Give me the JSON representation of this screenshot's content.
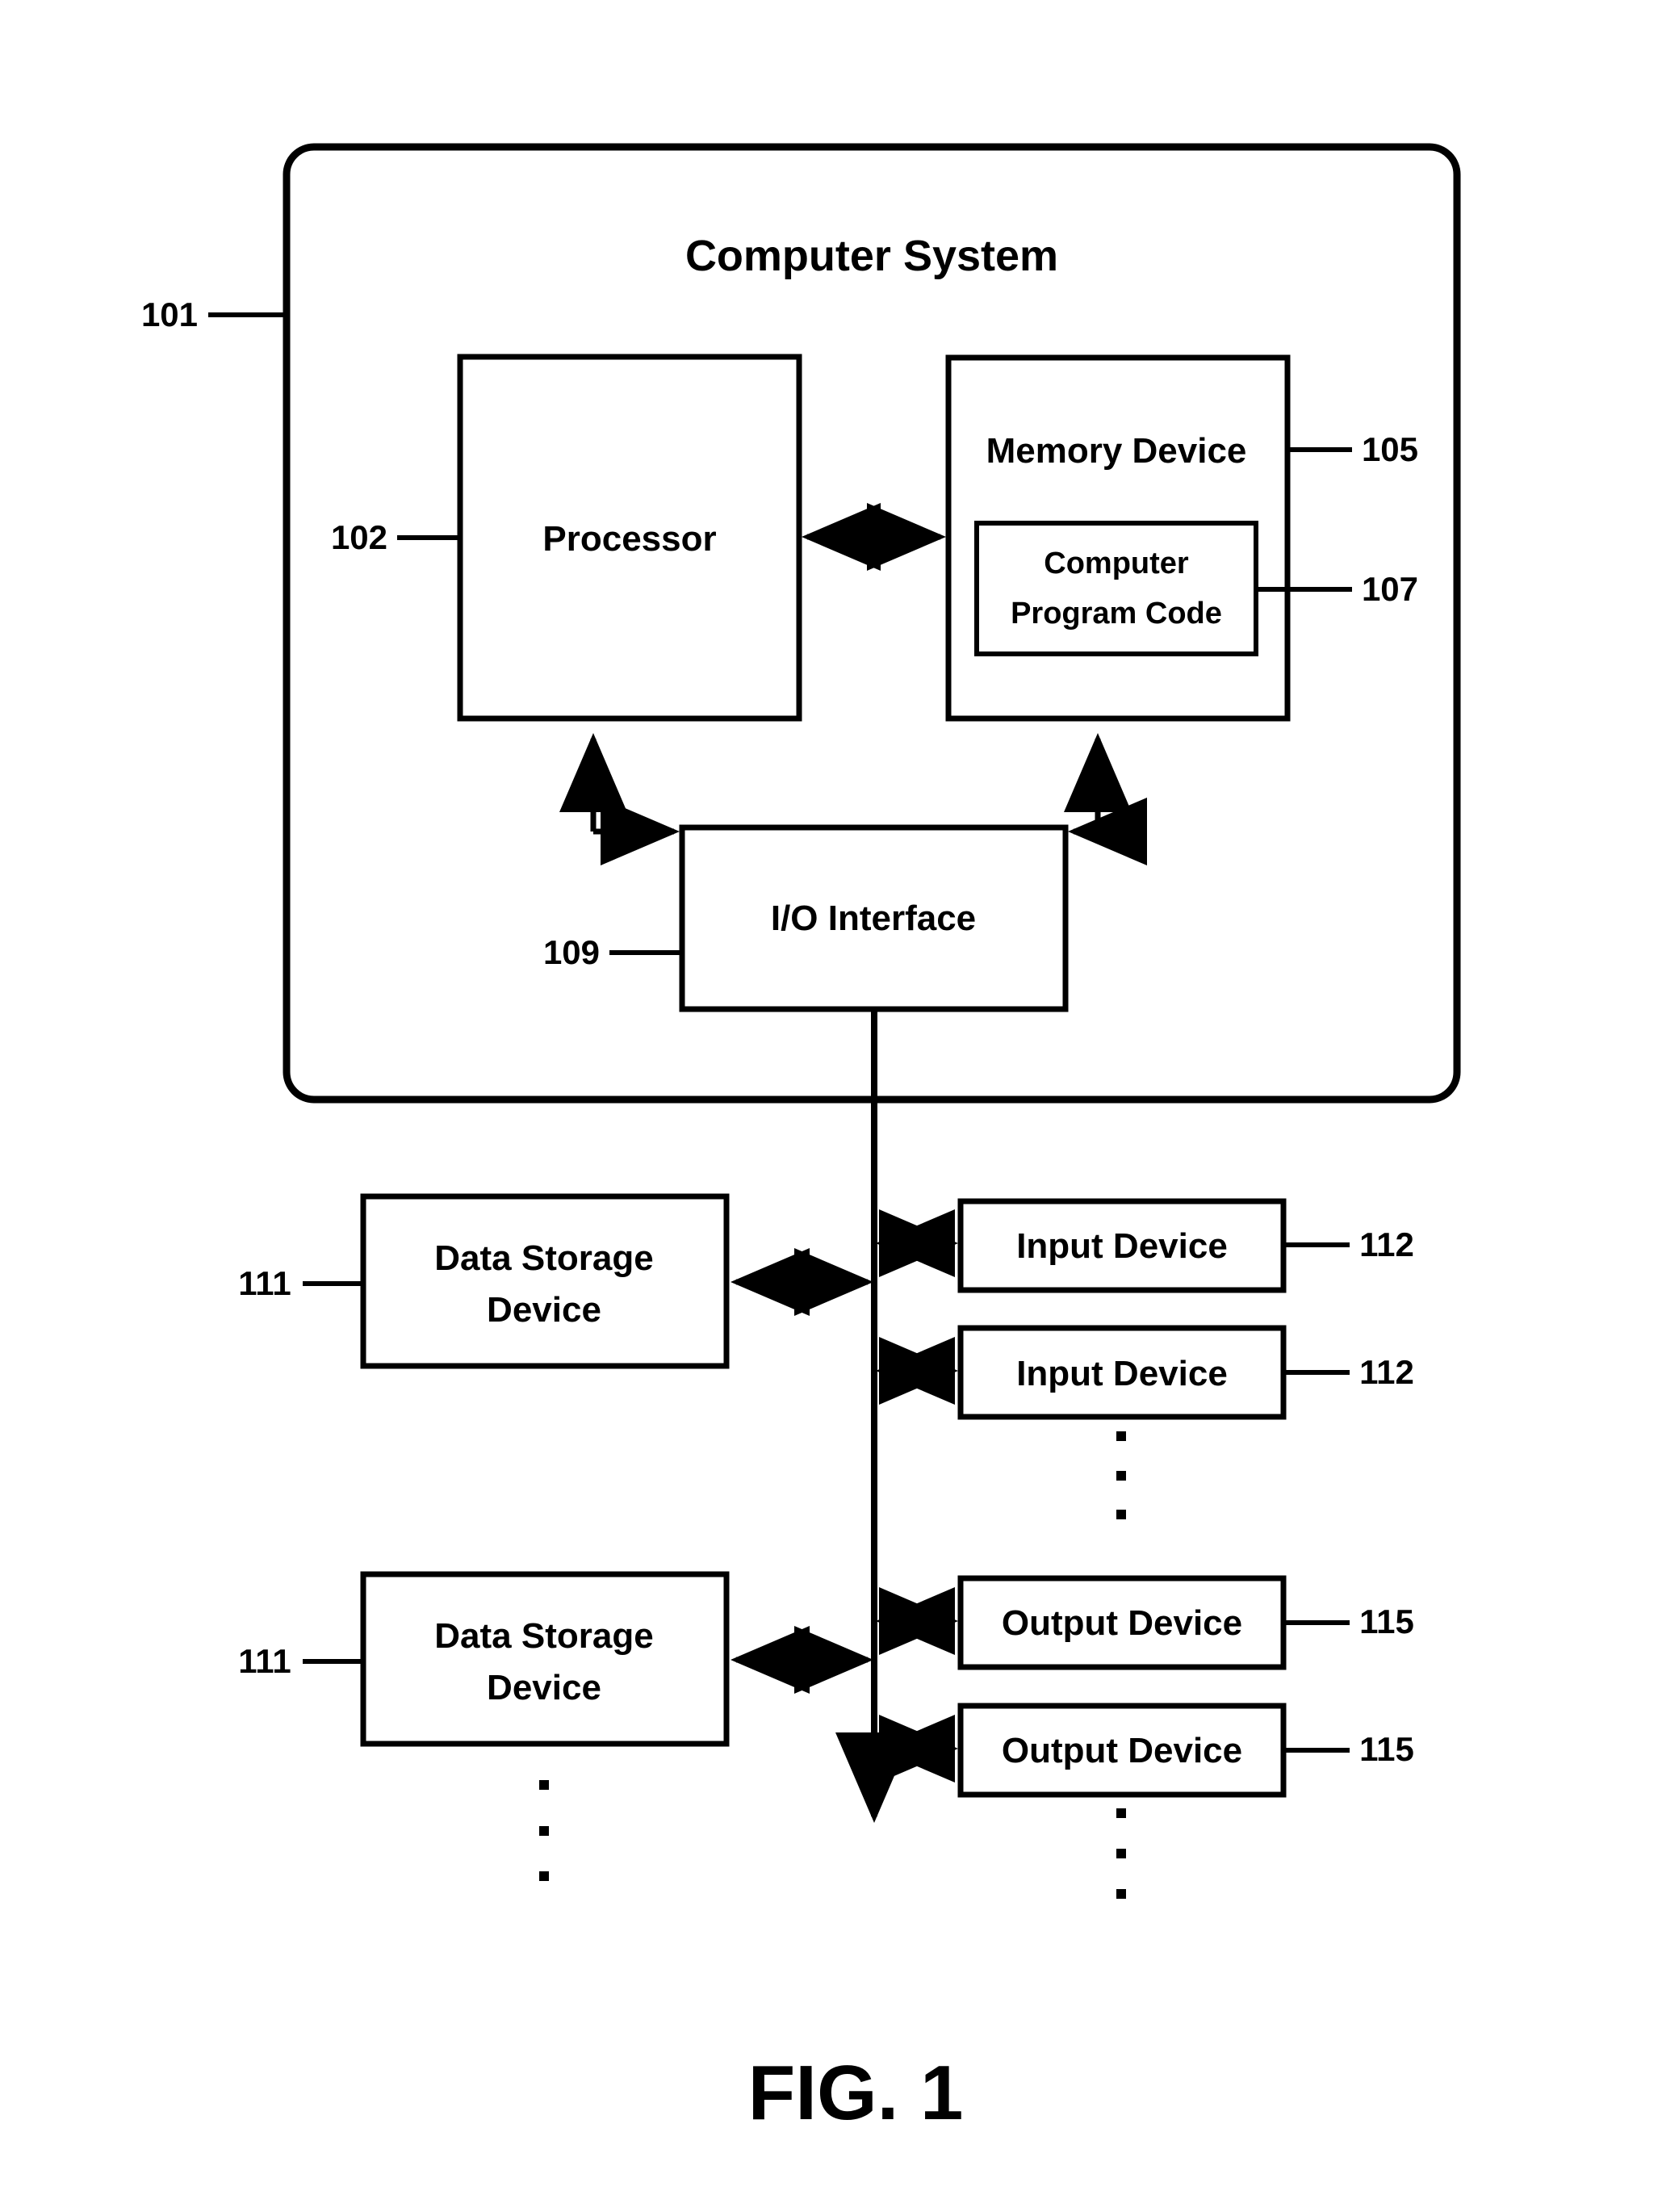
{
  "figure": {
    "caption": "FIG. 1",
    "title": "Computer System",
    "title_ref": "101"
  },
  "blocks": {
    "processor": {
      "label": "Processor",
      "ref": "102"
    },
    "memory_device": {
      "label": "Memory Device",
      "ref": "105"
    },
    "computer_program_code": {
      "label_line1": "Computer",
      "label_line2": "Program Code",
      "ref": "107"
    },
    "io_interface": {
      "label": "I/O Interface",
      "ref": "109"
    }
  },
  "peripherals": {
    "data_storage": [
      {
        "label_line1": "Data Storage",
        "label_line2": "Device",
        "ref": "111"
      },
      {
        "label_line1": "Data Storage",
        "label_line2": "Device",
        "ref": "111"
      }
    ],
    "input_devices": [
      {
        "label": "Input Device",
        "ref": "112"
      },
      {
        "label": "Input Device",
        "ref": "112"
      }
    ],
    "output_devices": [
      {
        "label": "Output Device",
        "ref": "115"
      },
      {
        "label": "Output Device",
        "ref": "115"
      }
    ]
  },
  "ellipses": {
    "glyph": "vertical-dots",
    "count": 3,
    "groups": [
      "input-devices-more",
      "output-devices-more",
      "data-storage-more"
    ]
  },
  "colors": {
    "stroke": "#000000",
    "background": "#ffffff",
    "text": "#000000"
  }
}
